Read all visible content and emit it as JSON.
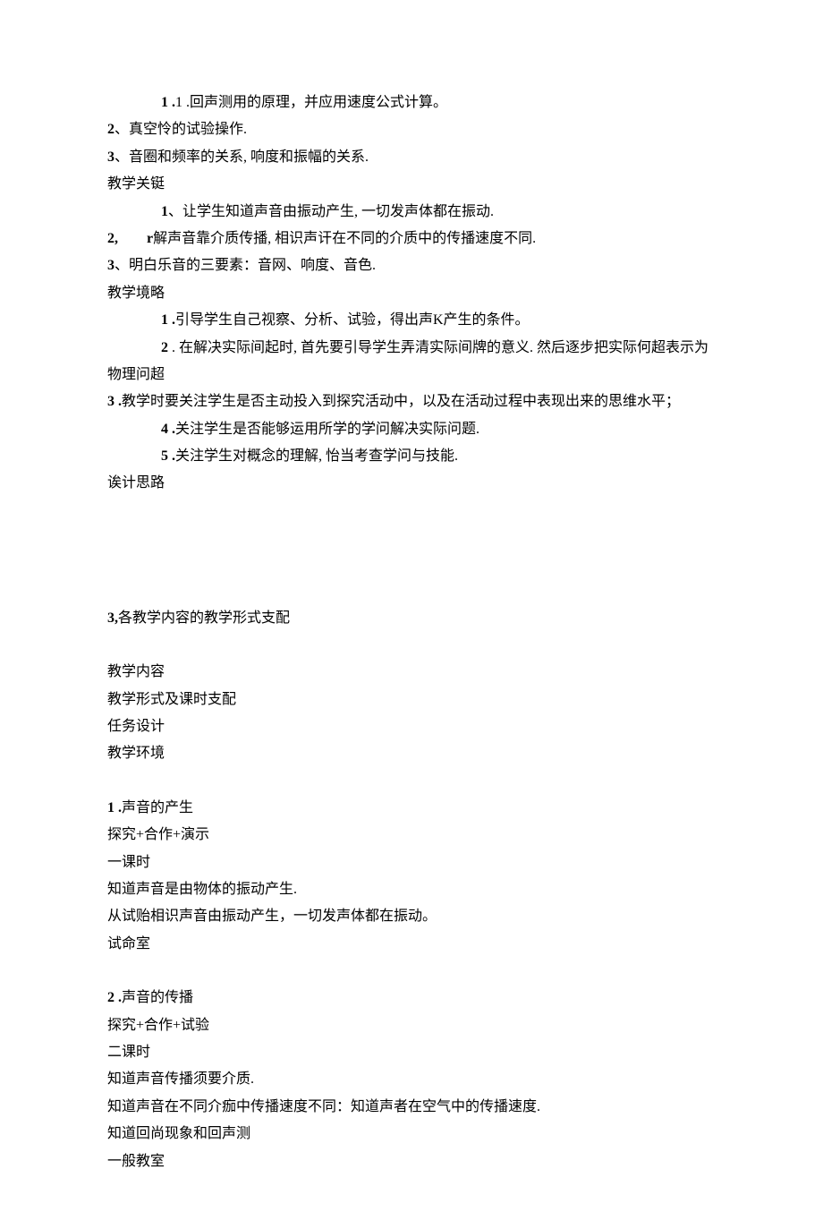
{
  "lines": {
    "l1": "1 .回声测用的原理，并应用速度公式计算。",
    "l2": "2、真空怜的试验操作.",
    "l3": "3、音圈和频率的关系, 响度和振幅的关系.",
    "l4": "教学关铤",
    "l5": "1、让学生知道声音由振动产生, 一切发声体都在振动.",
    "l6": "2,　　r解声音靠介质传播, 相识声讦在不同的介质中的传播速度不同.",
    "l7": "3、明白乐音的三要素：音网、响度、音色.",
    "l8": "教学境略",
    "l9": "1 .引导学生自己视察、分析、试验，得出声K产生的条件。",
    "l10": "2 . 在解决实际间起时, 首先要引导学生弄清实际间牌的意义. 然后逐步把实际何超表示为物理问超",
    "l11": "3 .教学时要关注学生是否主动投入到探究活动中，以及在活动过程中表现出来的思维水平；",
    "l12": "4 .关注学生是否能够运用所学的学问解决实际问题.",
    "l13": "5 .关注学生对概念的理解, 怡当考查学问与技能.",
    "l14": "诶计思路",
    "sec3_title": "3,各教学内容的教学形式支配",
    "hdr1": "教学内容",
    "hdr2": "教学形式及课时支配",
    "hdr3": "任务设计",
    "hdr4": "教学环境",
    "s1_1": "1 .声音的产生",
    "s1_2": "探究+合作+演示",
    "s1_3": "一课时",
    "s1_4": "知道声音是由物体的振动产生.",
    "s1_5": "从试贻相识声音由振动产生，一切发声体都在振动。",
    "s1_6": "试命室",
    "s2_1": "2 .声音的传播",
    "s2_2": "探究+合作+试验",
    "s2_3": "二课时",
    "s2_4": "知道声音传播须要介质.",
    "s2_5": "知道声音在不同介痂中传播速度不同：知道声者在空气中的传播速度.",
    "s2_6": "知道回尚现象和回声测",
    "s2_7": "一般教室"
  }
}
